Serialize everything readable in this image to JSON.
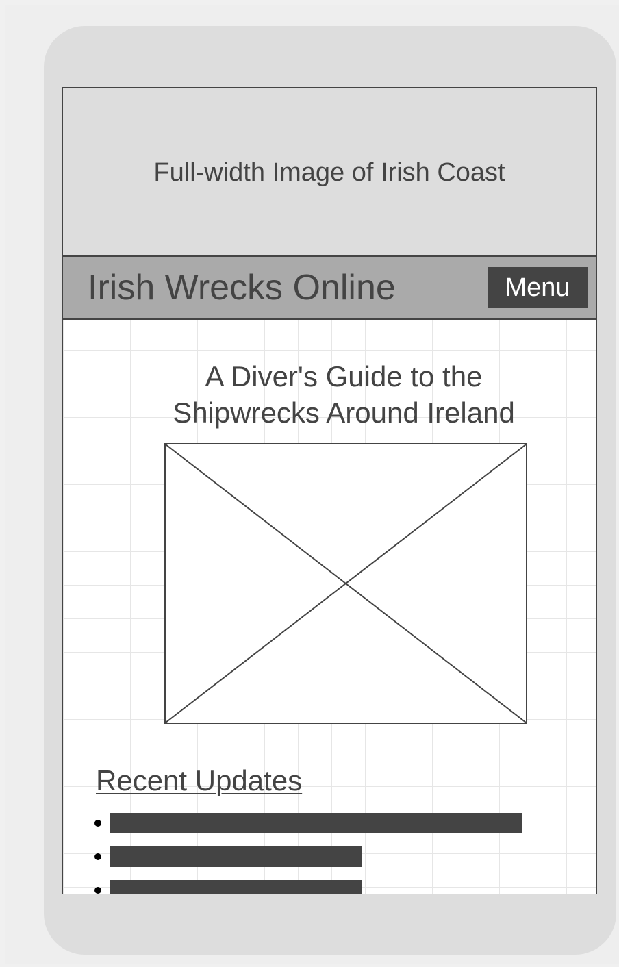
{
  "hero": {
    "label": "Full-width Image of Irish Coast"
  },
  "header": {
    "site_title": "Irish Wrecks Online",
    "menu_label": "Menu"
  },
  "main": {
    "tagline": "A Diver's Guide to the Shipwrecks Around Ireland",
    "recent_updates_heading": "Recent Updates",
    "updates": [
      {
        "bar_fill": 0.77
      },
      {
        "bar_fill": 0.47
      },
      {
        "bar_fill": 0.47
      }
    ]
  },
  "colors": {
    "phone_frame": "#dddddd",
    "header_bar": "#aaaaaa",
    "dark": "#444444",
    "grid_line": "#e6e6e6"
  }
}
